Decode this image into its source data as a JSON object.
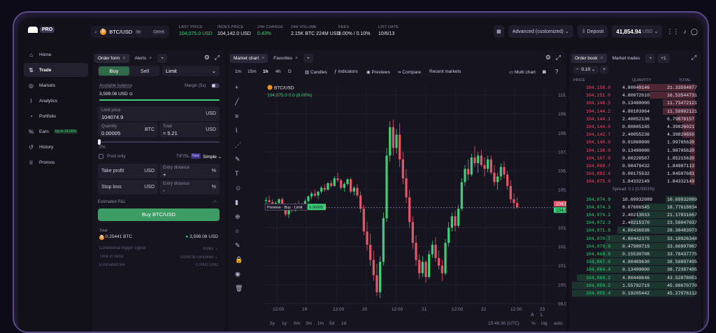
{
  "brand": {
    "pro": "PRO"
  },
  "pair": {
    "symbol": "BTC/USD",
    "badge": "5x",
    "shortcut": "Ctrl+K"
  },
  "stats": [
    {
      "label": "LAST PRICE",
      "value": "104,075.0 USD",
      "color": "#3ecf7a"
    },
    {
      "label": "INDEX PRICE",
      "value": "104,142.0 USD",
      "color": "#e8e6f0"
    },
    {
      "label": "24H CHANGE",
      "value": "0.43%",
      "color": "#3ecf7a"
    },
    {
      "label": "24H VOLUME",
      "value": "2.15K BTC  224M USD",
      "color": "#e8e6f0"
    },
    {
      "label": "FEES",
      "value": "0.00% / 0.10%",
      "color": "#e8e6f0"
    },
    {
      "label": "LIST DATE",
      "value": "10/6/13",
      "color": "#e8e6f0"
    }
  ],
  "topright": {
    "mode": "Advanced (customized)",
    "deposit": "Deposit",
    "balance": "41,854.94",
    "currency": "USD"
  },
  "nav": [
    {
      "label": "Home",
      "icon": "⌂"
    },
    {
      "label": "Trade",
      "icon": "⇅"
    },
    {
      "label": "Markets",
      "icon": "◎"
    },
    {
      "label": "Analytics",
      "icon": "⌇"
    },
    {
      "label": "Portfolio",
      "icon": "◔"
    },
    {
      "label": "Earn",
      "icon": "%",
      "badge": "Up to 24.00%"
    },
    {
      "label": "History",
      "icon": "↺"
    },
    {
      "label": "Promos",
      "icon": "♕"
    }
  ],
  "orderform": {
    "tabs": [
      "Order form",
      "Alerts"
    ],
    "buy": "Buy",
    "sell": "Sell",
    "ordertype": "Limit",
    "available_label": "Available balance",
    "available_value": "3,599.08 USD",
    "margin": "Margin (5x)",
    "limit_label": "Limit price",
    "limit_value": "104074.9",
    "usd": "USD",
    "qty_label": "Quantity",
    "qty_value": "0.00005",
    "btc": "BTC",
    "total_label": "Total",
    "total_value": "≈ 5.21",
    "pct": "0%",
    "postonly": "Post only",
    "tif": "TIF/SL",
    "new": "New",
    "simple": "Simple",
    "tp_label": "Take profit",
    "entry_label": "Entry distance",
    "plus": "+",
    "pctsign": "%",
    "sl_label": "Stop loss",
    "minus": "-",
    "est_label": "Estimated P&L",
    "est_value": "- / -",
    "submit": "Buy BTC/USD",
    "total_lbl": "Total",
    "total_btc": "0.25441 BTC",
    "total_usd": "3,599.08 USD",
    "cond_label": "Conditional trigger signal",
    "cond_value": "Index",
    "time_label": "Time in force",
    "time_value": "Good till canceled",
    "fee_label": "Estimated fee",
    "fee_value": "0.0000 USD"
  },
  "chart": {
    "tabs": [
      "Market chart",
      "Favorites"
    ],
    "intervals": [
      "1m",
      "15m",
      "1h",
      "4h",
      "D"
    ],
    "tools": [
      "Candles",
      "Indicators",
      "Previews",
      "Compare",
      "Recent markets"
    ],
    "multichart": "Multi chart",
    "symbol": "BTC/USD",
    "ohlc": "104,075.0  0.0 (0.00%)",
    "preview": "Preview · Buy · Limit",
    "preview_qty": "0.00005",
    "price_ask": "104,075.0",
    "price_bid": "104,074.9",
    "yticks": [
      "110,000.0",
      "109,000.0",
      "108,000.0",
      "107,000.0",
      "106,000.0",
      "105,000.0",
      "104,000.0",
      "103,000.0",
      "102,000.0",
      "101,000.0",
      "100,000.0",
      "99,000.0"
    ],
    "xticks": [
      "12:00",
      "19",
      "12:00",
      "20",
      "12:00",
      "21",
      "12:00",
      "22",
      "12:00",
      "23"
    ],
    "ranges": [
      "5y",
      "1y",
      "6m",
      "3m",
      "1m",
      "5d",
      "1d"
    ],
    "clock": "15:46:30 (UTC)",
    "pct": "%",
    "log": "log",
    "auto": "auto"
  },
  "orderbook": {
    "tabs": [
      "Order book",
      "Market trades"
    ],
    "step": "0.10",
    "headers": [
      "PRICE",
      "QUANTITY",
      "TOTAL"
    ],
    "asks": [
      [
        "104,158.0",
        "4.80040146",
        "21.33584877"
      ],
      [
        "104,151.0",
        "4.80072610",
        "16.53544731"
      ],
      [
        "104,148.5",
        "0.13490000",
        "11.73472121"
      ],
      [
        "104,144.2",
        "4.80103964",
        "11.59982121"
      ],
      [
        "104,144.1",
        "2.40052136",
        "6.79878157"
      ],
      [
        "104,144.0",
        "0.00005165",
        "4.39826021"
      ],
      [
        "104,142.7",
        "2.40055236",
        "4.39820856"
      ],
      [
        "104,140.0",
        "0.01060000",
        "1.99765620"
      ],
      [
        "104,138.0",
        "0.13490000",
        "1.98705620"
      ],
      [
        "104,107.0",
        "0.00228507",
        "1.85215620"
      ],
      [
        "104,099.7",
        "0.00479432",
        "1.84987113"
      ],
      [
        "104,082.4",
        "0.00175532",
        "1.84507681"
      ],
      [
        "104,075.0",
        "1.84332149",
        "1.84332149"
      ]
    ],
    "spread": "Spread: 0.1 (0.0001%)",
    "bids": [
      [
        "104,074.9",
        "10.69932089",
        "10.69932089"
      ],
      [
        "104,074.3",
        "8.07686545",
        "18.77618634"
      ],
      [
        "104,074.2",
        "2.40213033",
        "21.17831667"
      ],
      [
        "104,072.3",
        "2.40215370",
        "23.58047037"
      ],
      [
        "104,071.9",
        "4.80436936",
        "28.38483973"
      ],
      [
        "104,070.7",
        "4.80442375",
        "33.18926348"
      ],
      [
        "104,070.0",
        "0.47980719",
        "33.66907067"
      ],
      [
        "104,069.9",
        "0.15530708",
        "33.78437775"
      ],
      [
        "104,067.0",
        "4.80409630",
        "38.58897405"
      ],
      [
        "104,064.4",
        "0.13490000",
        "38.72387405"
      ],
      [
        "104,060.2",
        "4.80440646",
        "43.52878051"
      ],
      [
        "104,059.2",
        "1.55792719",
        "45.08670770"
      ],
      [
        "104,055.4",
        "0.19205442",
        "45.27876112"
      ]
    ],
    "ask_fill": [
      0.47,
      0.37,
      0.26,
      0.26,
      0.15,
      0.1,
      0.1,
      0.04,
      0.04,
      0.04,
      0.04,
      0.04,
      0.04
    ],
    "bid_fill": [
      0.24,
      0.42,
      0.47,
      0.52,
      0.63,
      0.73,
      0.74,
      0.75,
      0.85,
      0.86,
      0.96,
      1.0,
      1.0
    ]
  },
  "candles": [
    [
      104400,
      104600,
      104200,
      104450
    ],
    [
      104450,
      104700,
      104300,
      104350
    ],
    [
      104350,
      104500,
      104100,
      104250
    ],
    [
      104250,
      104400,
      104050,
      104300
    ],
    [
      104300,
      104550,
      104200,
      104500
    ],
    [
      104500,
      104600,
      104100,
      104150
    ],
    [
      104150,
      104200,
      103600,
      103700
    ],
    [
      103700,
      104100,
      103500,
      104000
    ],
    [
      104000,
      104200,
      103800,
      103900
    ],
    [
      103900,
      104300,
      103850,
      104250
    ],
    [
      104250,
      104450,
      104100,
      104150
    ],
    [
      104150,
      104300,
      103900,
      104200
    ],
    [
      104200,
      104500,
      104100,
      104400
    ],
    [
      104400,
      104700,
      104300,
      104650
    ],
    [
      104650,
      104900,
      104500,
      104800
    ],
    [
      104800,
      105000,
      104600,
      104700
    ],
    [
      104700,
      104950,
      104500,
      104900
    ],
    [
      104900,
      105200,
      104800,
      105100
    ],
    [
      105100,
      105300,
      104900,
      105000
    ],
    [
      105000,
      105400,
      104950,
      105350
    ],
    [
      105350,
      105500,
      105100,
      105200
    ],
    [
      105200,
      105700,
      105150,
      105600
    ],
    [
      105600,
      105900,
      105400,
      105500
    ],
    [
      105500,
      105600,
      105000,
      105100
    ],
    [
      105100,
      105400,
      104900,
      105300
    ],
    [
      105300,
      105600,
      105200,
      105550
    ],
    [
      105550,
      105650,
      104800,
      104900
    ],
    [
      104900,
      105200,
      104700,
      105100
    ],
    [
      105100,
      105300,
      104600,
      104700
    ],
    [
      104700,
      104900,
      103800,
      104000
    ],
    [
      104000,
      104200,
      102600,
      102800
    ],
    [
      102800,
      103300,
      101800,
      102100
    ],
    [
      102100,
      102700,
      101000,
      101300
    ],
    [
      101300,
      101800,
      100200,
      100500
    ],
    [
      100500,
      101100,
      99400,
      99600
    ],
    [
      99600,
      101500,
      99300,
      101200
    ],
    [
      101200,
      103800,
      101000,
      103500
    ],
    [
      103500,
      107200,
      103300,
      106800
    ],
    [
      106800,
      108600,
      106500,
      108300
    ],
    [
      108300,
      108700,
      106800,
      107200
    ],
    [
      107200,
      108200,
      106900,
      107900
    ],
    [
      107900,
      108500,
      106200,
      106600
    ],
    [
      106600,
      107000,
      105300,
      105600
    ],
    [
      105600,
      106100,
      104300,
      104600
    ],
    [
      104600,
      105000,
      103000,
      103300
    ],
    [
      103300,
      103600,
      101900,
      102200
    ],
    [
      102200,
      102600,
      101000,
      101300
    ],
    [
      101300,
      101600,
      100300,
      100600
    ],
    [
      100600,
      101500,
      100400,
      101200
    ],
    [
      101200,
      101300,
      100100,
      100400
    ],
    [
      100400,
      101800,
      100300,
      101600
    ],
    [
      101600,
      102300,
      101400,
      102100
    ],
    [
      102100,
      102500,
      101200,
      101400
    ],
    [
      101400,
      101800,
      100800,
      101000
    ],
    [
      101000,
      101300,
      100200,
      100600
    ],
    [
      100600,
      102400,
      100500,
      102200
    ],
    [
      102200,
      103300,
      102000,
      103000
    ],
    [
      103000,
      103800,
      102800,
      103600
    ],
    [
      103600,
      103900,
      102800,
      103100
    ],
    [
      103100,
      104200,
      103000,
      104000
    ],
    [
      104000,
      105600,
      103900,
      105400
    ],
    [
      105400,
      106300,
      105200,
      106100
    ],
    [
      106100,
      106600,
      105500,
      105800
    ],
    [
      105800,
      106900,
      105700,
      106700
    ],
    [
      106700,
      107300,
      106200,
      106400
    ],
    [
      106400,
      107000,
      105900,
      106800
    ],
    [
      106800,
      107100,
      106200,
      106300
    ],
    [
      106300,
      106700,
      105700,
      106100
    ],
    [
      106100,
      106800,
      105900,
      106600
    ],
    [
      106600,
      106800,
      105800,
      105900
    ],
    [
      105900,
      106300,
      105200,
      105400
    ],
    [
      105400,
      105900,
      105000,
      105700
    ],
    [
      105700,
      106400,
      105500,
      106200
    ],
    [
      106200,
      106500,
      105600,
      105800
    ],
    [
      105800,
      106000,
      105000,
      105200
    ],
    [
      105200,
      105500,
      104300,
      104500
    ],
    [
      104500,
      104800,
      104000,
      104300
    ],
    [
      104300,
      104600,
      104000,
      104075
    ]
  ]
}
